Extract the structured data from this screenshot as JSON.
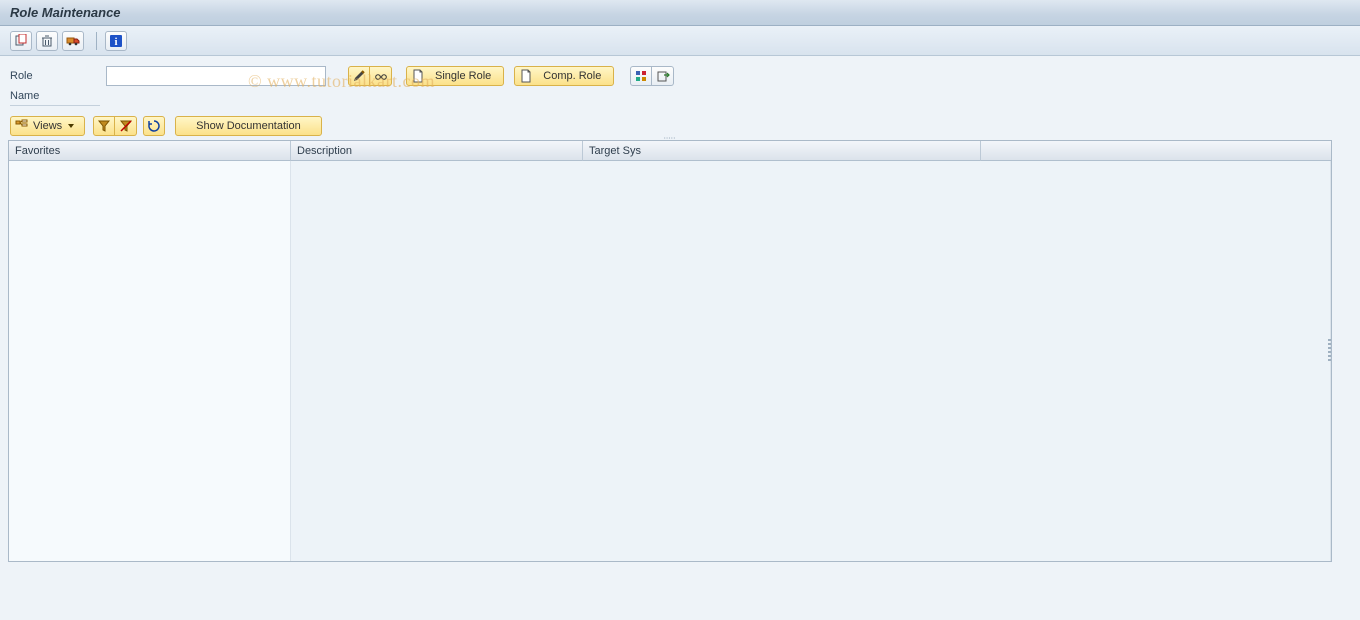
{
  "title": "Role Maintenance",
  "watermark": "© www.tutorialkart.com",
  "toolbar": {
    "icons": {
      "copy": "copy-icon",
      "delete": "delete-icon",
      "transport": "transport-icon",
      "info": "info-icon"
    }
  },
  "form": {
    "role_label": "Role",
    "role_value": "",
    "name_label": "Name"
  },
  "roleActions": {
    "edit_icon": "pencil-icon",
    "display_icon": "glasses-icon",
    "single_role_label": "Single Role",
    "comp_role_label": "Comp. Role",
    "where_used_icon": "where-used-icon",
    "download_icon": "download-icon"
  },
  "subToolbar": {
    "views_label": "Views",
    "filter_icon": "filter-icon",
    "filter_off_icon": "filter-off-icon",
    "refresh_icon": "refresh-icon",
    "show_documentation_label": "Show Documentation"
  },
  "table": {
    "columns": {
      "favorites": "Favorites",
      "description": "Description",
      "target_sys": "Target Sys"
    },
    "rows": []
  }
}
